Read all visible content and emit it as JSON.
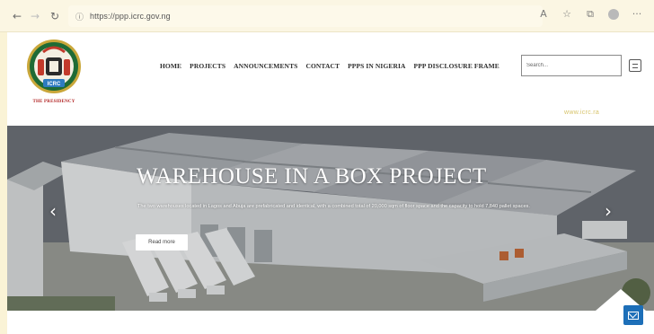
{
  "browser": {
    "back_glyph": "←",
    "forward_glyph": "→",
    "reload_glyph": "↻",
    "lock_glyph": "ⓘ",
    "url": "https://ppp.icrc.gov.ng",
    "toolbar_icons": [
      {
        "name": "read-aloud-icon",
        "glyph": "A"
      },
      {
        "name": "favorite-star-icon",
        "glyph": "☆"
      },
      {
        "name": "collections-icon",
        "glyph": "⧉"
      },
      {
        "name": "profile-icon",
        "glyph": ""
      },
      {
        "name": "more-menu-icon",
        "glyph": "···"
      }
    ]
  },
  "header": {
    "logo_caption": "THE PRESIDENCY",
    "nav": [
      "HOME",
      "PROJECTS",
      "ANNOUNCEMENTS",
      "CONTACT",
      "PPPS IN NIGERIA",
      "PPP DISCLOSURE FRAME"
    ],
    "search_placeholder": "Search...",
    "site_tag": "www.icrc.ra",
    "logo_badge": "ICRC"
  },
  "hero": {
    "title": "WAREHOUSE IN A BOX PROJECT",
    "description": "The two warehouses located in Lagos and Abuja are prefabricated and identical, with a combined total of 20,000 sqm of floor space and the capacity to hold 7,840 pallet spaces.",
    "cta_label": "Read more",
    "prev_glyph": "‹",
    "next_glyph": "›"
  },
  "colors": {
    "page_background": "#faf3d6",
    "logo_caption": "#b12222",
    "mail_button": "#1d6fb8",
    "site_tag": "#d7c36a"
  }
}
